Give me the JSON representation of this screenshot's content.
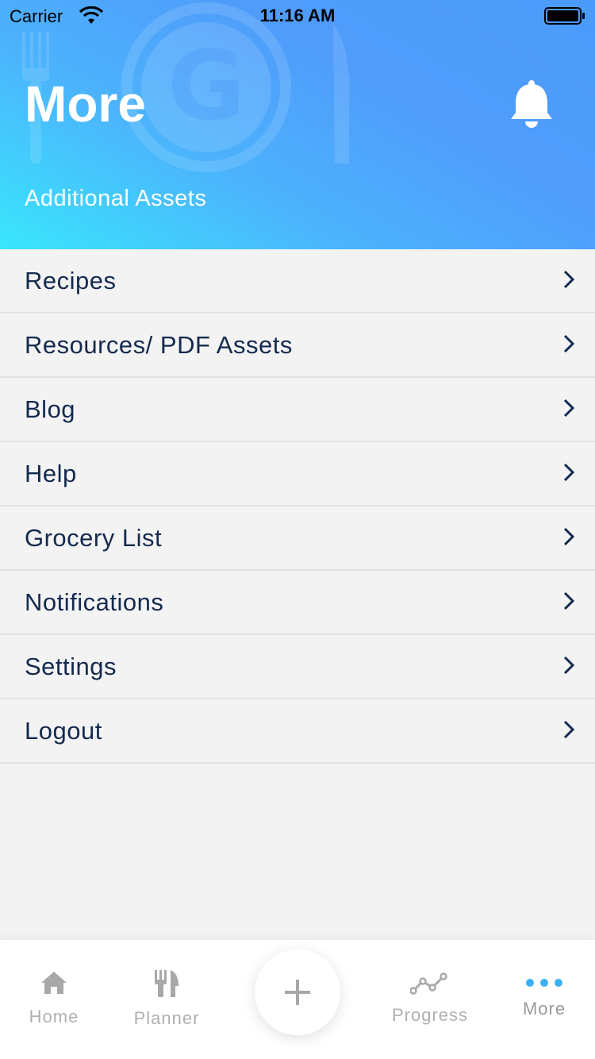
{
  "status_bar": {
    "carrier": "Carrier",
    "time": "11:16 AM"
  },
  "header": {
    "title": "More",
    "subtitle": "Additional Assets",
    "notification_icon": "bell-icon",
    "gradient_colors": [
      "#39e6fc",
      "#4c9bfa"
    ]
  },
  "menu": {
    "items": [
      {
        "label": "Recipes"
      },
      {
        "label": "Resources/ PDF Assets"
      },
      {
        "label": "Blog"
      },
      {
        "label": "Help"
      },
      {
        "label": "Grocery List"
      },
      {
        "label": "Notifications"
      },
      {
        "label": "Settings"
      },
      {
        "label": "Logout"
      }
    ],
    "text_color": "#142a4e"
  },
  "tab_bar": {
    "tabs": [
      {
        "label": "Home",
        "icon": "home-icon"
      },
      {
        "label": "Planner",
        "icon": "fork-knife-icon"
      },
      {
        "label": "Progress",
        "icon": "progress-graph-icon"
      },
      {
        "label": "More",
        "icon": "more-dots-icon",
        "active": true
      }
    ],
    "add_icon": "plus-icon",
    "active_color": "#3bb0f5"
  }
}
